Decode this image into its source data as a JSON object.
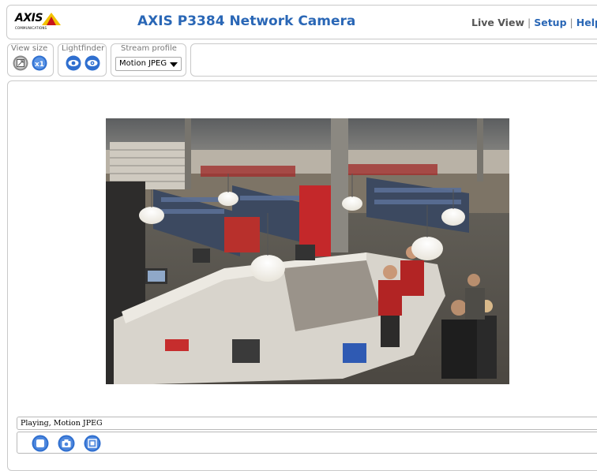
{
  "header": {
    "logo_text": "AXIS",
    "logo_subtext": "COMMUNICATIONS",
    "title": "AXIS P3384 Network Camera",
    "nav": {
      "live_view": "Live View",
      "setup": "Setup",
      "help": "Help"
    }
  },
  "toolbar": {
    "view_size": {
      "label": "View size",
      "icons": [
        "fit-to-window-icon",
        "full-size-icon"
      ]
    },
    "lightfinder": {
      "label": "Lightfinder",
      "icons": [
        "lightfinder-off-icon",
        "lightfinder-on-icon"
      ]
    },
    "stream_profile": {
      "label": "Stream profile",
      "selected": "Motion JPEG"
    }
  },
  "status": {
    "text": "Playing, Motion JPEG"
  },
  "controls": {
    "icons": [
      "stop-icon",
      "snapshot-icon",
      "fullscreen-icon"
    ]
  },
  "colors": {
    "accent": "#2a67b6",
    "icon_blue": "#2f6fcf",
    "logo_yellow": "#f2c200"
  }
}
